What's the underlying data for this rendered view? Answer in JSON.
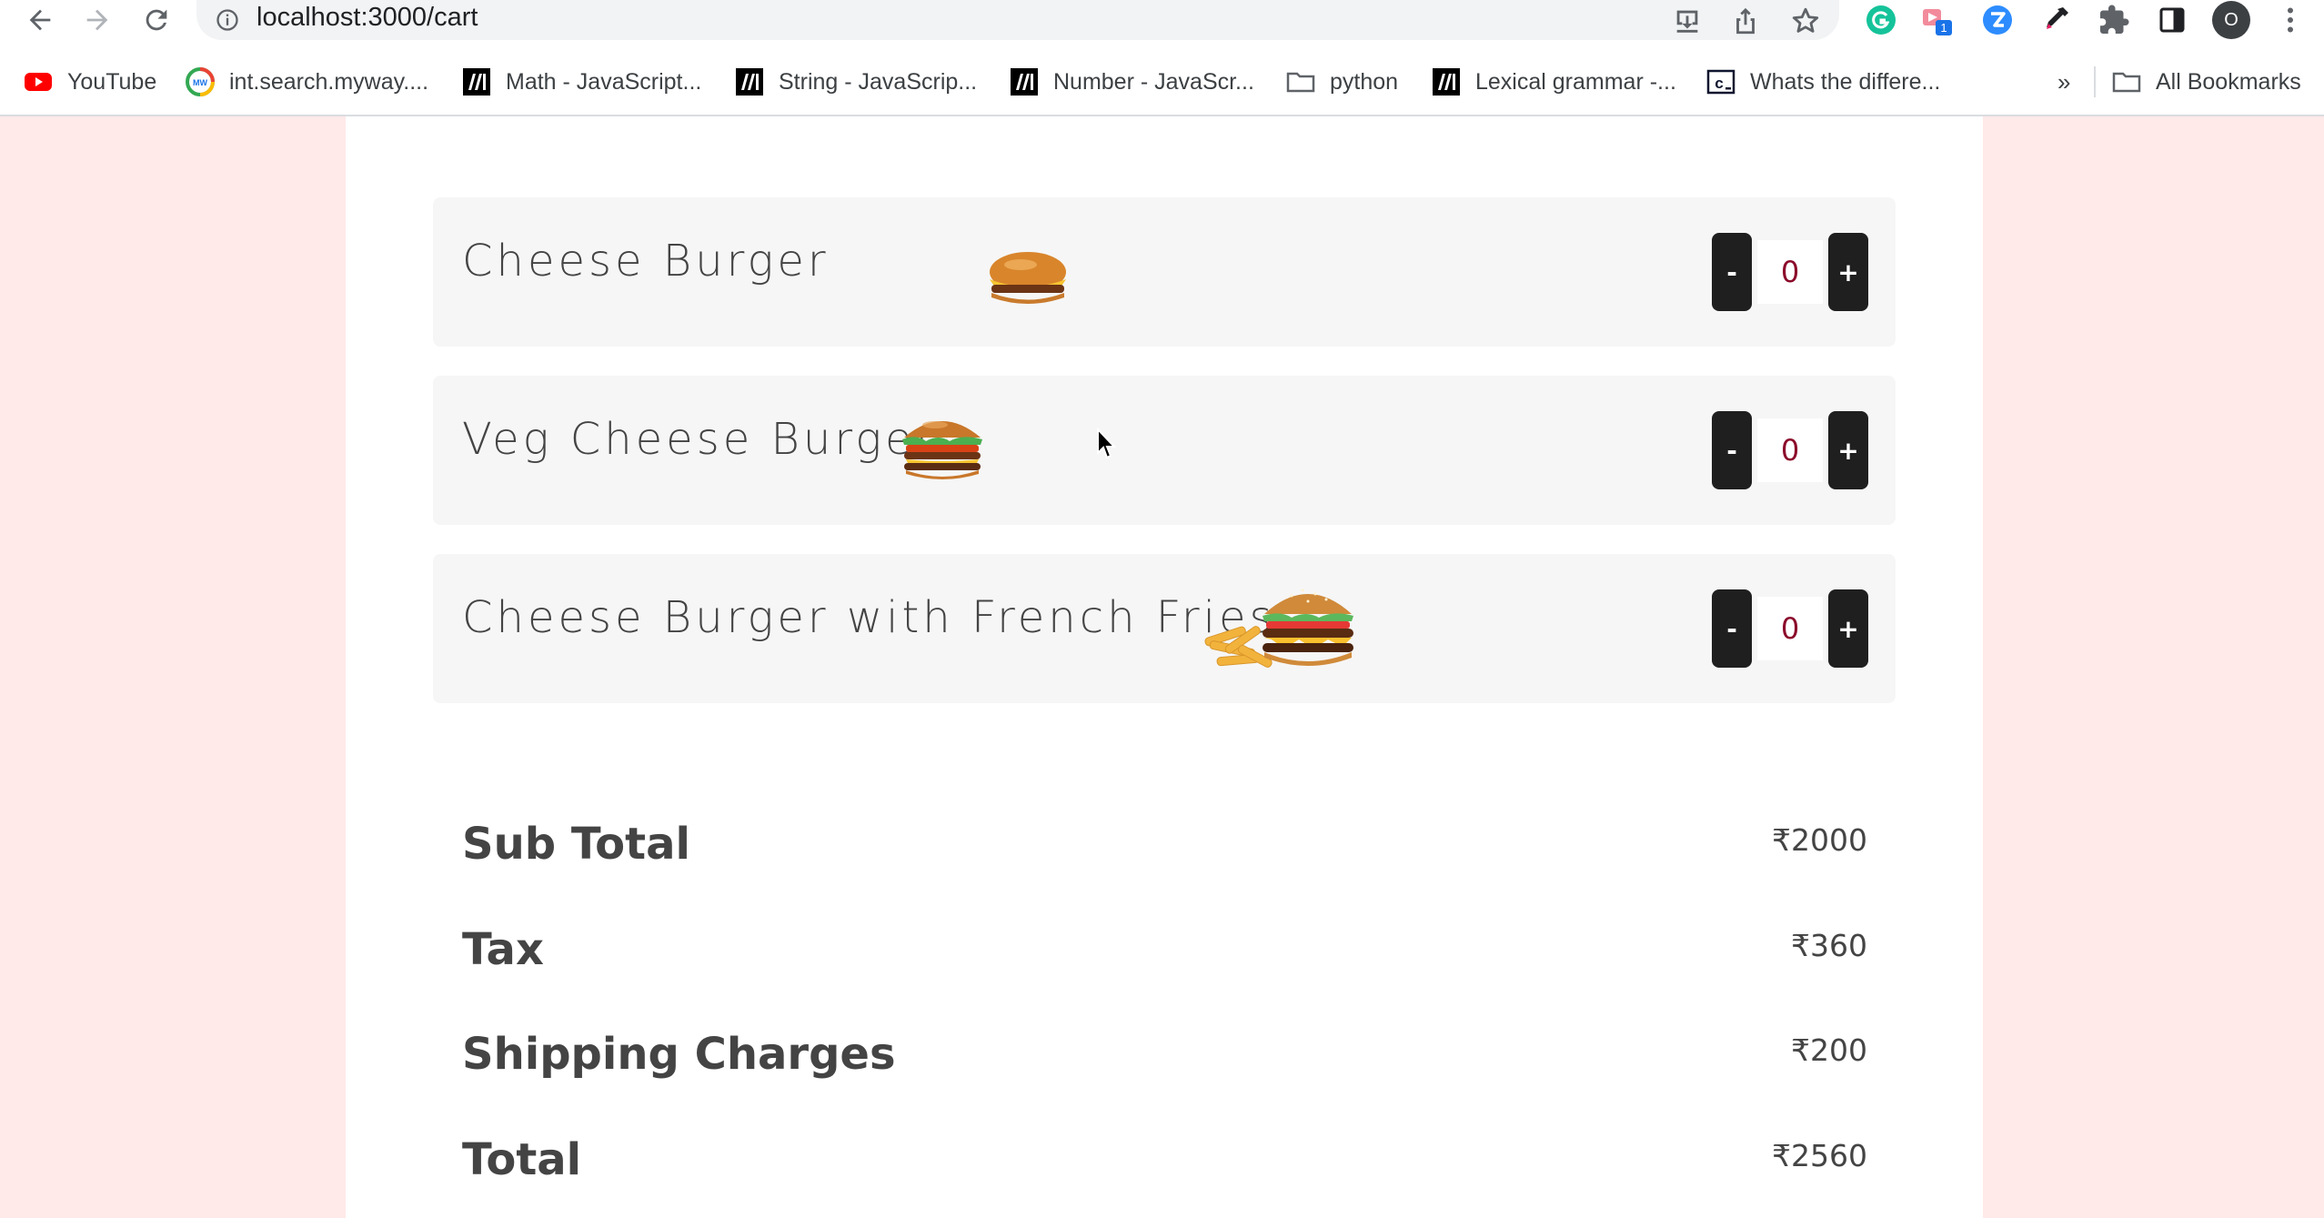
{
  "browser": {
    "url": "localhost:3000/cart",
    "extension_badge": "1",
    "profile_initial": "O"
  },
  "bookmarks": {
    "items": [
      {
        "label": "YouTube",
        "icon": "youtube-icon"
      },
      {
        "label": "int.search.myway....",
        "icon": "myway-icon"
      },
      {
        "label": "Math - JavaScript...",
        "icon": "mdn-icon"
      },
      {
        "label": "String - JavaScrip...",
        "icon": "mdn-icon"
      },
      {
        "label": "Number - JavaScr...",
        "icon": "mdn-icon"
      },
      {
        "label": "python",
        "icon": "folder-icon"
      },
      {
        "label": "Lexical grammar -...",
        "icon": "mdn-icon"
      },
      {
        "label": "Whats the differe...",
        "icon": "codecademy-icon"
      }
    ],
    "overflow": "»",
    "all_bookmarks": "All Bookmarks"
  },
  "cart": {
    "items": [
      {
        "name": "Cheese Burger",
        "quantity": "0",
        "minus": "-",
        "plus": "+",
        "image": "cheese-burger-image"
      },
      {
        "name": "Veg Cheese Burger",
        "quantity": "0",
        "minus": "-",
        "plus": "+",
        "image": "veg-cheese-burger-image"
      },
      {
        "name": "Cheese Burger with French Fries",
        "quantity": "0",
        "minus": "-",
        "plus": "+",
        "image": "burger-fries-image"
      }
    ],
    "summary": {
      "subtotal_label": "Sub Total",
      "subtotal_value": "₹2000",
      "tax_label": "Tax",
      "tax_value": "₹360",
      "shipping_label": "Shipping Charges",
      "shipping_value": "₹200",
      "total_label": "Total",
      "total_value": "₹2560"
    }
  },
  "colors": {
    "page_background": "#ffe9e9",
    "card_background": "#f6f6f6",
    "button_background": "#1f1f1f",
    "quantity_text": "#8b0a2a",
    "text": "#444444"
  }
}
